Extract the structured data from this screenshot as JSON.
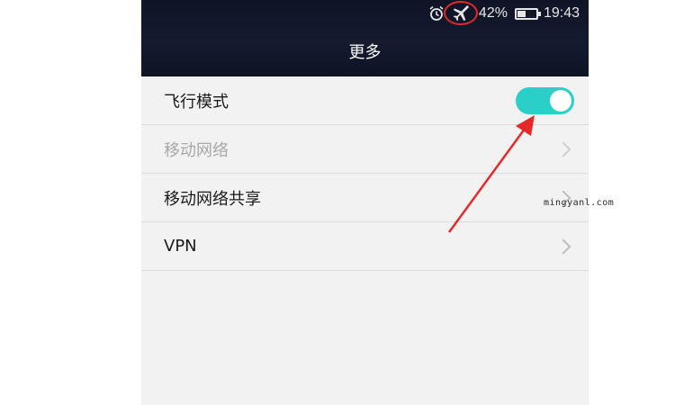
{
  "status_bar": {
    "icons": [
      "alarm-icon",
      "airplane-icon",
      "battery-icon"
    ],
    "battery_percent": "42%",
    "battery_level": 0.42,
    "time": "19:43"
  },
  "header": {
    "title": "更多"
  },
  "settings": {
    "items": [
      {
        "label": "飞行模式",
        "control": "toggle",
        "toggle_on": true
      },
      {
        "label": "移动网络",
        "control": "chevron",
        "disabled": true
      },
      {
        "label": "移动网络共享",
        "control": "chevron"
      },
      {
        "label": "VPN",
        "control": "chevron"
      }
    ]
  },
  "colors": {
    "header_bg": "#141b2f",
    "toggle_on": "#2ad0c7",
    "annotation_red": "#e52929",
    "list_bg": "#f2f2f2"
  },
  "watermark": "mingyanl.com"
}
